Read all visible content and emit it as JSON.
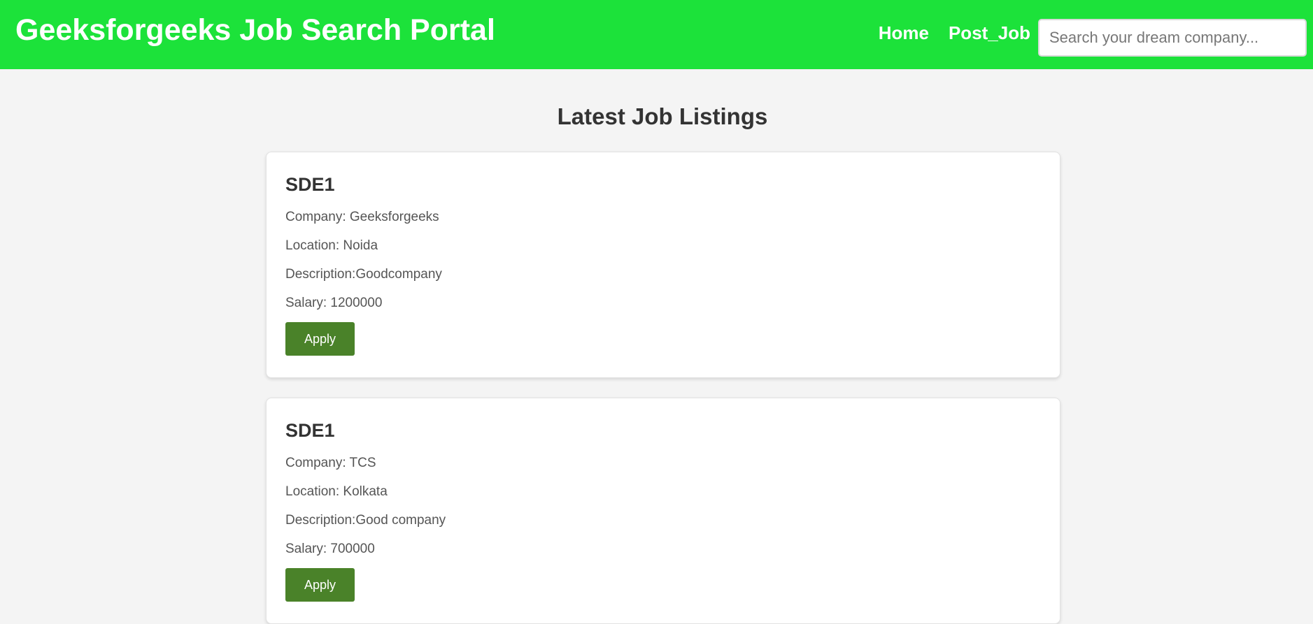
{
  "header": {
    "title": "Geeksforgeeks Job Search Portal",
    "nav": {
      "home": "Home",
      "post_job": "Post_Job"
    },
    "search": {
      "placeholder": "Search your dream company...",
      "value": ""
    },
    "colors": {
      "header_bg": "#1ce23a",
      "apply_button_bg": "#4a8229"
    }
  },
  "main": {
    "section_title": "Latest Job Listings",
    "jobs": [
      {
        "title": "SDE1",
        "company": "Company: Geeksforgeeks",
        "location": "Location: Noida",
        "description": "Description:Goodcompany",
        "salary": "Salary: 1200000",
        "apply_label": "Apply"
      },
      {
        "title": "SDE1",
        "company": "Company: TCS",
        "location": "Location: Kolkata",
        "description": "Description:Good company",
        "salary": "Salary: 700000",
        "apply_label": "Apply"
      }
    ]
  }
}
